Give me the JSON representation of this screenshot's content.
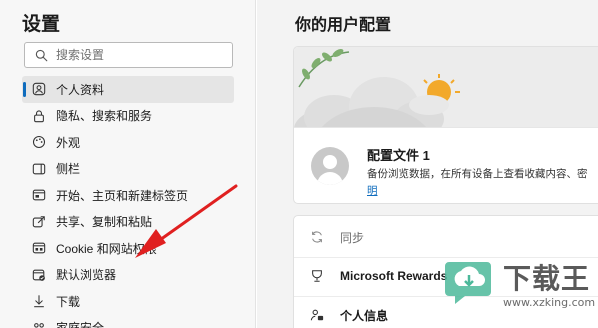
{
  "sidebar": {
    "title": "设置",
    "search_placeholder": "搜索设置",
    "items": [
      {
        "label": "个人资料",
        "icon": "profile-icon",
        "active": true
      },
      {
        "label": "隐私、搜索和服务",
        "icon": "lock-icon"
      },
      {
        "label": "外观",
        "icon": "appearance-icon"
      },
      {
        "label": "侧栏",
        "icon": "sidebar-icon"
      },
      {
        "label": "开始、主页和新建标签页",
        "icon": "home-icon"
      },
      {
        "label": "共享、复制和粘贴",
        "icon": "share-icon"
      },
      {
        "label": "Cookie 和网站权限",
        "icon": "site-permissions-icon"
      },
      {
        "label": "默认浏览器",
        "icon": "default-browser-icon"
      },
      {
        "label": "下载",
        "icon": "download-icon"
      },
      {
        "label": "家庭安全",
        "icon": "family-icon"
      }
    ]
  },
  "main": {
    "title": "你的用户配置",
    "profile": {
      "name": "配置文件 1",
      "description": "备份浏览数据，在所有设备上查看收藏内容、密",
      "link": "明"
    },
    "rows": [
      {
        "label": "同步",
        "icon": "sync-icon"
      },
      {
        "label": "Microsoft Rewards",
        "icon": "rewards-icon"
      },
      {
        "label": "个人信息",
        "icon": "personal-info-icon"
      }
    ]
  },
  "watermark": {
    "brand": "下载王",
    "url": "www.xzking.com"
  },
  "colors": {
    "accent": "#0f6cbd",
    "annotation_arrow": "#e02020",
    "watermark_green": "#4cb89a"
  }
}
